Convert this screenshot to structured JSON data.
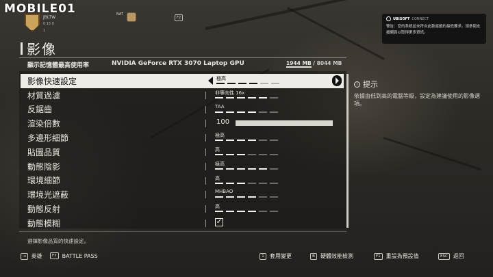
{
  "watermark": "MOBILE01",
  "player": {
    "name": "JBLTW",
    "stats": "0  15  0",
    "level": "1"
  },
  "faction_tag": "NAT",
  "hotkey_f2": "F2",
  "ubisoft": {
    "brand": "UBISOFT",
    "connect": "CONNECT",
    "message": "警告：您的系統並未符合此款遊戲的最低要求。請參閱支援網頁以取得更多資訊。"
  },
  "page_title": "影像",
  "vram": {
    "label": "顯示記憶體最高使用率",
    "gpu": "NVIDIA GeForce RTX 3070 Laptop GPU",
    "used": "1944 MB",
    "separator": " / ",
    "total": "8044 MB"
  },
  "settings": [
    {
      "label": "影像快速設定",
      "value": "極高",
      "level": 4
    },
    {
      "label": "材質過濾",
      "value": "非等向性 16x",
      "level": 5
    },
    {
      "label": "反鋸齒",
      "value": "TAA",
      "level": 4
    },
    {
      "label": "渲染倍數",
      "value": "100"
    },
    {
      "label": "多邊形細節",
      "value": "極高",
      "level": 4
    },
    {
      "label": "貼圖品質",
      "value": "高",
      "level": 3
    },
    {
      "label": "動態陰影",
      "value": "極高",
      "level": 5
    },
    {
      "label": "環境細節",
      "value": "高",
      "level": 3
    },
    {
      "label": "環境光遮蔽",
      "value": "MHBAO",
      "level": 4
    },
    {
      "label": "動態反射",
      "value": "高",
      "level": 4
    },
    {
      "label": "動態模糊",
      "value": "✓"
    }
  ],
  "tip": {
    "title": "提示",
    "body": "依據由低到高的電腦等級，設定為建議使用的影像選項。"
  },
  "description": "選擇影像品質的快速設定。",
  "footer": {
    "left": [
      {
        "key": "⇥",
        "label": "英雄"
      },
      {
        "key": "F7",
        "label": "BATTLE PASS"
      }
    ],
    "right": [
      {
        "key": "1",
        "label": "套用變更"
      },
      {
        "key": "B",
        "label": "硬體效能檢測"
      },
      {
        "key": "F1",
        "label": "重設為預設值"
      },
      {
        "key": "ESC",
        "label": "返回"
      }
    ]
  }
}
